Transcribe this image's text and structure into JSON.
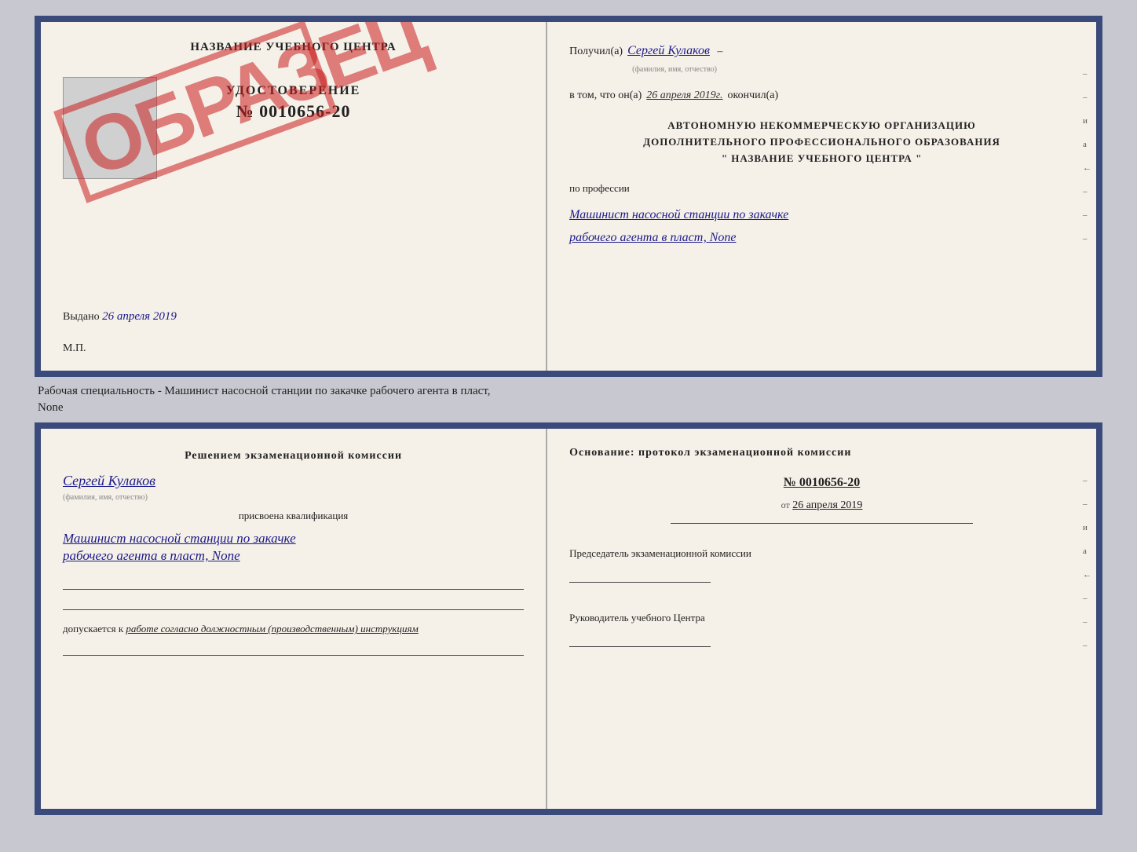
{
  "top_doc": {
    "left": {
      "center_name": "НАЗВАНИЕ УЧЕБНОГО ЦЕНТРА",
      "udostoverenie_title": "УДОСТОВЕРЕНИЕ",
      "udostoverenie_num": "№ 0010656-20",
      "vydano_label": "Выдано",
      "vydano_date": "26 апреля 2019",
      "mp_label": "М.П.",
      "obrazec": "ОБРАЗЕЦ"
    },
    "right": {
      "poluchil_label": "Получил(а)",
      "poluchil_name": "Сергей Кулаков",
      "fio_hint": "(фамилия, имя, отчество)",
      "vtom_label": "в том, что он(а)",
      "vtom_date": "26 апреля 2019г.",
      "okonchil_label": "окончил(а)",
      "org_line1": "АВТОНОМНУЮ НЕКОММЕРЧЕСКУЮ ОРГАНИЗАЦИЮ",
      "org_line2": "ДОПОЛНИТЕЛЬНОГО ПРОФЕССИОНАЛЬНОГО ОБРАЗОВАНИЯ",
      "org_line3": "\" НАЗВАНИЕ УЧЕБНОГО ЦЕНТРА \"",
      "professiya_label": "по профессии",
      "professiya_line1": "Машинист насосной станции по закачке",
      "professiya_line2": "рабочего агента в пласт, None"
    }
  },
  "separator": {
    "text_line1": "Рабочая специальность - Машинист насосной станции по закачке рабочего агента в пласт,",
    "text_line2": "None"
  },
  "bottom_doc": {
    "left": {
      "reshenie_text": "Решением  экзаменационной  комиссии",
      "komissia_name": "Сергей Кулаков",
      "komissia_hint": "(фамилия, имя, отчество)",
      "prisvoena_text": "присвоена квалификация",
      "kvalif_line1": "Машинист насосной станции по закачке",
      "kvalif_line2": "рабочего агента в пласт, None",
      "dopuskaetsya_label": "допускается к",
      "dopuskaetsya_value": "работе согласно должностным (производственным) инструкциям"
    },
    "right": {
      "osnovanie_text": "Основание:  протокол экзаменационной  комиссии",
      "protocol_num": "№  0010656-20",
      "ot_label": "от",
      "protocol_date": "26 апреля 2019",
      "predsedatel_label": "Председатель экзаменационной комиссии",
      "rukovoditel_label": "Руководитель учебного Центра"
    }
  },
  "side_marks": [
    "-",
    "-",
    "и",
    "а",
    "←",
    "-",
    "-",
    "-"
  ]
}
